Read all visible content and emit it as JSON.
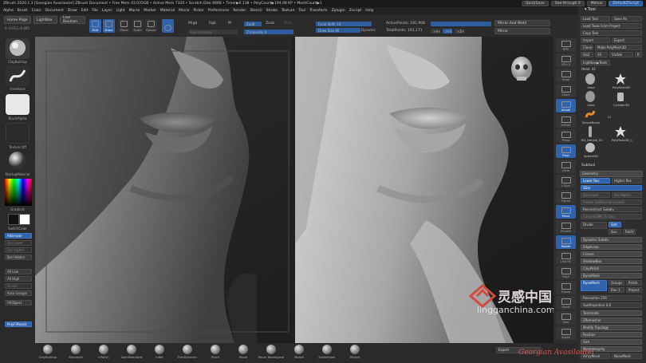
{
  "titlebar": {
    "title": "ZBrush 2020.1.3 [Georgian Avasiloutei]  ZBrush Document  • Free Mem 43.035GB • Active Mem 7320 • Scratch Disk 6668 • Timer▶0.138 • PolyCount▶194.08 KP • MeshCount▶1",
    "quicksave": "QuickSave",
    "see_through": "See-through  0",
    "menus": "Menus",
    "default_zscript": "DefaultZScript"
  },
  "menubar": {
    "items": [
      "Alpha",
      "Brush",
      "Color",
      "Document",
      "Draw",
      "Edit",
      "File",
      "Layer",
      "Light",
      "Macro",
      "Marker",
      "Material",
      "Movie",
      "Picker",
      "Preferences",
      "Render",
      "Stencil",
      "Stroke",
      "Texture",
      "Tool",
      "Transform",
      "Zplugin",
      "Zscript",
      "Help"
    ]
  },
  "toolbar": {
    "home_page": "Home Page",
    "lightbox": "LightBox",
    "live_boolean": "Live Boolean",
    "coords": "0.-0.013,-0.465",
    "edit": "Edit",
    "draw": "Draw",
    "move": "Move",
    "scale": "Scale",
    "rotate": "Rotate",
    "mrgb": "Mrgb",
    "rgb": "Rgb",
    "m": "M",
    "zadd": "Zadd",
    "zsub": "Zsub",
    "zcut": "Zcut",
    "rgb_intensity": "Rgb Intensity",
    "z_intensity": "Z Intensity 4",
    "focal_shift": "Focal Shift -16",
    "draw_size": "Draw Size 46",
    "dynamic": "Dynamic",
    "active_points": "ActivePoints: 191,908",
    "total_points": "TotalPoints: 191,171",
    "mirror_and_weld": "Mirror And Weld",
    "mirror": "Mirror",
    "x": ">X<",
    "y": ">Y<",
    "z": ">Z<"
  },
  "leftshelf": {
    "clay_buildup": "ClayBuildup",
    "freehand": "FreeHand",
    "brush_alpha": "BrushAlpha",
    "texture_off": "Texture Off",
    "startup_material": "StartupMaterial",
    "gradient": "Gradient",
    "switch_color": "SwitchColor",
    "buttons": [
      "Alternate",
      "Del Lower",
      "Del Higher",
      "Del Hidden",
      "All Low",
      "All High",
      "Divide",
      "Auto Groups",
      "FillObject"
    ],
    "blue_bottom": "PolyF.Mosaic"
  },
  "rightbar": {
    "buttons": [
      "BPR",
      "SPix 3",
      "Scroll",
      "Zoom",
      "Actual",
      "AAHalf",
      "Persp",
      "Floor",
      "Local",
      "L.Sym",
      "Frame",
      "Move",
      "ZoomD",
      "Rotate",
      "Line Fill",
      "PolyF",
      "Transp",
      "Ghost",
      "Solo",
      "Xpose"
    ]
  },
  "tray": {
    "header": "Tool",
    "load_tool": "Load Tool",
    "save_as": "Save As",
    "load_tools_from_project": "Load Tools From Project",
    "copy_tool": "Copy Tool",
    "import": "Import",
    "export": "Export",
    "clone": "Clone",
    "make_polymesh3d": "Make PolyMesh3D",
    "goz": "GoZ",
    "all": "All",
    "visible": "Visible",
    "r": "R",
    "lightbox_tools": "Lightbox▶Tools",
    "head_count": "Head. 41",
    "tools": [
      {
        "label": "head"
      },
      {
        "label": "PolyMesh3D"
      },
      {
        "label": "head"
      },
      {
        "label": "Cylinder3D"
      },
      {
        "label": "SimpleBrush"
      },
      {
        "label": "11"
      },
      {
        "label": "HD_Female_01"
      },
      {
        "label": "PolyMesh3D_1"
      },
      {
        "label": "Sphere3D"
      }
    ],
    "subtool": "Subtool",
    "geometry": "Geometry",
    "lower_res": "Lower Res",
    "higher_res": "Higher Res",
    "sdiv": "SDiv",
    "del_lower": "Del Lower",
    "del_higher": "Del Higher",
    "freeze_subdivision_levels": "Freeze SubDivision Levels",
    "reconstruct_subdiv": "Reconstruct Subdiv",
    "convert_bpr_to_geo": "Convert BPR To Geo",
    "divide": "Divide",
    "smt": "Smt",
    "suv": "Suv",
    "reuv": "ReUV",
    "dynamic_subdiv": "Dynamic Subdiv",
    "edge_loop": "EdgeLoop",
    "crease": "Crease",
    "shadowbox": "ShadowBox",
    "clay_polish": "ClayPolish",
    "dynamesh": "DynaMesh",
    "groups": "Groups",
    "polish": "Polish",
    "blur": "Blur 2",
    "project": "Project",
    "resolution": "Resolution 256",
    "subprojection": "SubProjection 0.6",
    "tessimate": "Tessimate",
    "zremesher": "ZRemesher",
    "modify_topology": "Modify Topology",
    "position": "Position",
    "size": "Size",
    "meshintegrity": "MeshIntegrity",
    "export_bottom": "Export",
    "array_mesh": "ArrayMesh",
    "nano_mesh": "NanoMesh"
  },
  "bottomshelf": {
    "brushes": [
      "ClayBuildup",
      "Standard",
      "hPolish",
      "DamStandard",
      "Inflat",
      "TrimDynamic",
      "Pinch",
      "Move",
      "Move Topological",
      "Morph",
      "SnakeHook",
      "Morph"
    ]
  },
  "watermark": {
    "brand_cn": "灵感中国",
    "brand_url": "lingganchina.com",
    "signature": "Georgian Avasiloutei"
  },
  "colors": {
    "accent_blue": "#2f63ad",
    "panel_dark": "#2b2b2b",
    "watermark_red": "#c0392b"
  }
}
